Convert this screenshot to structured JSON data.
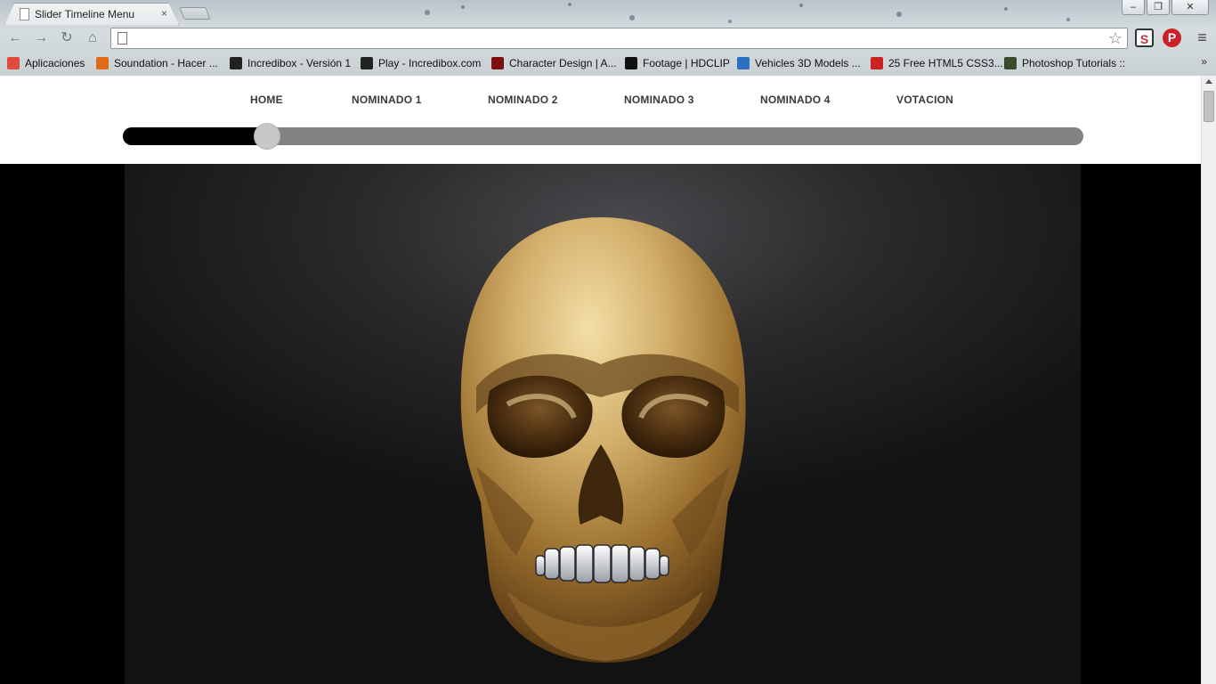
{
  "browser": {
    "tab_title": "Slider Timeline Menu",
    "tab_close": "×",
    "address_value": "",
    "bookmarks": [
      {
        "label": "Aplicaciones",
        "icon": "apps-grid-icon",
        "color": "#e04b3f"
      },
      {
        "label": "Soundation - Hacer ...",
        "icon": "soundation-icon",
        "color": "#e06a1a"
      },
      {
        "label": "Incredibox - Versión 1",
        "icon": "incredibox-icon",
        "color": "#222222"
      },
      {
        "label": "Play - Incredibox.com",
        "icon": "incredibox-icon",
        "color": "#222222"
      },
      {
        "label": "Character Design | A...",
        "icon": "cd-icon",
        "color": "#7a1010"
      },
      {
        "label": "Footage | HDCLIP",
        "icon": "hdclip-icon",
        "color": "#111111"
      },
      {
        "label": "Vehicles 3D Models ...",
        "icon": "3d-icon",
        "color": "#2a6fc0"
      },
      {
        "label": "25 Free HTML5 CSS3...",
        "icon": "html5-icon",
        "color": "#cc2222"
      },
      {
        "label": "Photoshop Tutorials ::",
        "icon": "photoshop-icon",
        "color": "#3a4a2a"
      }
    ],
    "more_label": "»",
    "extensions": {
      "s": "S",
      "p": "P"
    }
  },
  "page": {
    "nav": [
      "HOME",
      "NOMINADO 1",
      "NOMINADO 2",
      "NOMINADO 3",
      "NOMINADO 4",
      "VOTACION"
    ],
    "timeline_progress_percent": 15
  },
  "colors": {
    "nav_text": "#3a3a3a",
    "timeline_track": "#828282",
    "timeline_fill": "#000000",
    "timeline_thumb": "#c8c8c8",
    "skull_gold": "#c9a96a"
  }
}
